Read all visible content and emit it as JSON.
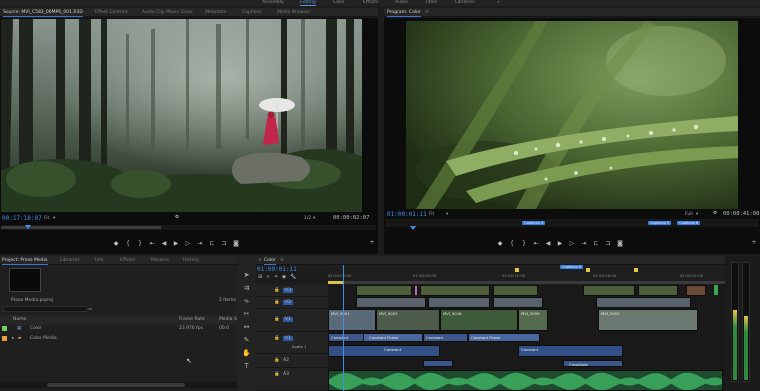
{
  "workspaces": [
    "Assembly",
    "Editing",
    "Color",
    "Effects",
    "Audio",
    "Titles",
    "Libraries",
    "»"
  ],
  "active_workspace": "Editing",
  "source_tabs": [
    "Source: MVI_C583_06MP6_001.R3D",
    "Effect Controls",
    "Audio Clip Mixer: Color",
    "Metadata",
    "Captions",
    "Media Browser"
  ],
  "source": {
    "timecode": "00:17:18:07",
    "fit_label": "Fit",
    "ratio_label": "1/2",
    "duration": "00:00:02:07"
  },
  "program_tabs": [
    "Program: Color"
  ],
  "program": {
    "timecode": "01:00:01:11",
    "fit_label": "Fit",
    "ratio_label": "Full",
    "duration": "00:00:41:08",
    "markers": [
      "Captions 3",
      "Captions 5",
      "Captions 6"
    ]
  },
  "project_tabs": [
    "Project: Prose Media",
    "Libraries",
    "Info",
    "Effects",
    "Markers",
    "History"
  ],
  "project": {
    "file_name": "Prose Media.prproj",
    "item_count": "2 Items",
    "columns": {
      "name": "Name",
      "frame_rate": "Frame Rate",
      "media_start": "Media S"
    },
    "items": [
      {
        "name": "Color",
        "frame_rate": "23.976 fps",
        "media_start": "00:0",
        "color": "#6fcf63"
      },
      {
        "name": "Color Media",
        "frame_rate": "",
        "media_start": "",
        "color": "#e5a03a"
      }
    ]
  },
  "timeline_tabs": [
    "Color"
  ],
  "timeline": {
    "timecode": "01:00:01:11",
    "ruler": [
      "01:00:00:00",
      "01:00:05:00",
      "01:00:11:00",
      "01:00:16:00",
      "01:00:21:00"
    ],
    "marker": "Captions 6",
    "tracks": {
      "v": [
        "V3",
        "V2",
        "V1"
      ],
      "a": [
        "A1",
        "A2",
        "A3"
      ],
      "audio_label": "Audio 1"
    },
    "clips": {
      "v1": [
        "MVI_5001",
        "MVI_5002",
        "MVI_5016",
        "MVI_5009",
        "MVI_5003"
      ],
      "captions": [
        "Constant",
        "Constant Power",
        "Constant",
        "Constant Power",
        "Constant",
        "Crossfade"
      ]
    }
  },
  "tools": [
    "selection",
    "track-select",
    "ripple",
    "razor",
    "slip",
    "pen",
    "hand",
    "type"
  ],
  "accent": "#3d8fe8",
  "clip_color_pink": "#b86fbf",
  "label_color_green": "#6fcf63",
  "label_color_orange": "#e5a03a"
}
